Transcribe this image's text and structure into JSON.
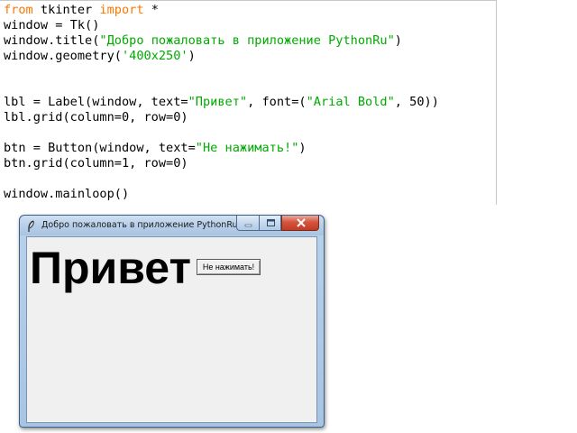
{
  "editor": {
    "lines": [
      [
        {
          "t": "from",
          "c": "kw"
        },
        {
          "t": " tkinter ",
          "c": ""
        },
        {
          "t": "import",
          "c": "kw"
        },
        {
          "t": " *",
          "c": ""
        }
      ],
      [
        {
          "t": "window = Tk()",
          "c": ""
        }
      ],
      [
        {
          "t": "window.title(",
          "c": ""
        },
        {
          "t": "\"Добро пожаловать в приложение PythonRu\"",
          "c": "str"
        },
        {
          "t": ")",
          "c": ""
        }
      ],
      [
        {
          "t": "window.geometry(",
          "c": ""
        },
        {
          "t": "'400x250'",
          "c": "str"
        },
        {
          "t": ")",
          "c": ""
        }
      ],
      [],
      [],
      [
        {
          "t": "lbl = Label(window, text=",
          "c": ""
        },
        {
          "t": "\"Привет\"",
          "c": "str"
        },
        {
          "t": ", font=(",
          "c": ""
        },
        {
          "t": "\"Arial Bold\"",
          "c": "str"
        },
        {
          "t": ", 50))",
          "c": ""
        }
      ],
      [
        {
          "t": "lbl.grid(column=0, row=0)",
          "c": ""
        }
      ],
      [],
      [
        {
          "t": "btn = Button(window, text=",
          "c": ""
        },
        {
          "t": "\"Не нажимать!\"",
          "c": "str"
        },
        {
          "t": ")",
          "c": ""
        }
      ],
      [
        {
          "t": "btn.grid(column=1, row=0)",
          "c": ""
        }
      ],
      [],
      [
        {
          "t": "window.mainloop()",
          "c": ""
        }
      ]
    ]
  },
  "tk_window": {
    "title": "Добро пожаловать в приложение PythonRu",
    "label_text": "Привет",
    "button_text": "Не нажимать!"
  },
  "colors": {
    "keyword": "#ff7700",
    "string": "#00aa00",
    "plain": "#000000",
    "client_bg": "#f0f0f0",
    "close_button": "#c23a22"
  },
  "icons": {
    "app_icon": "feather-icon",
    "minimize": "minimize-icon",
    "maximize": "maximize-icon",
    "close": "close-icon"
  }
}
